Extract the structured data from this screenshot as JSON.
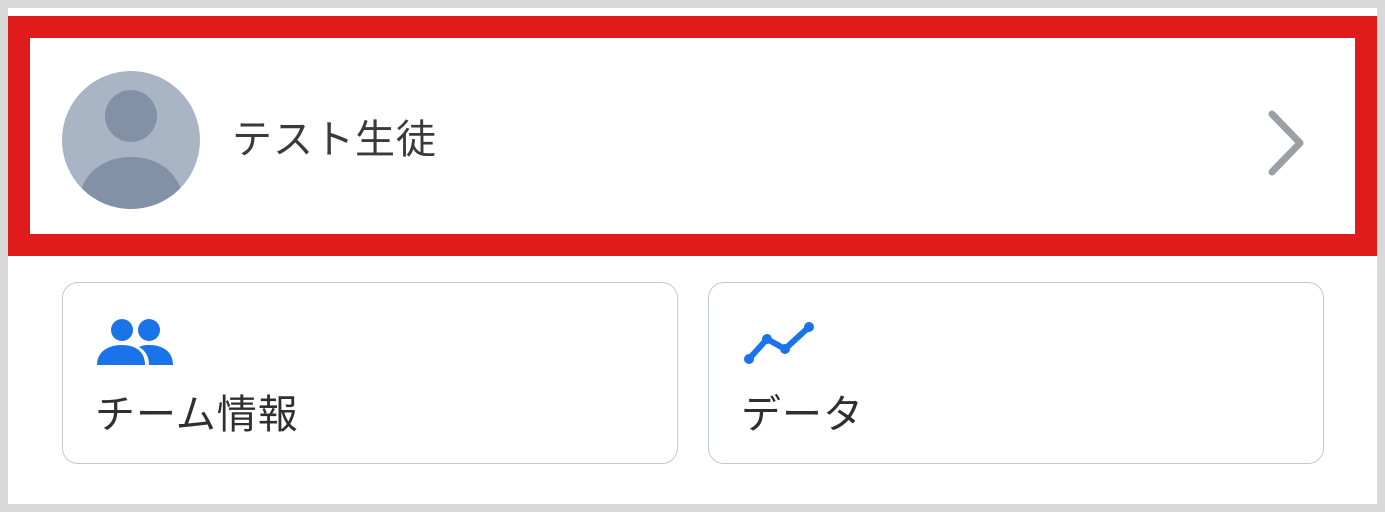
{
  "profile": {
    "name": "テスト生徒",
    "avatar_icon": "default-person-avatar-icon",
    "chevron_icon": "chevron-right-icon"
  },
  "cards": {
    "team": {
      "label": "チーム情報",
      "icon": "people-group-icon"
    },
    "data": {
      "label": "データ",
      "icon": "trending-line-icon"
    }
  },
  "colors": {
    "highlight_border": "#e01b1b",
    "accent_blue": "#1a73e8",
    "avatar_bg": "#a9b4c4",
    "avatar_figure": "#8391a7",
    "chevron": "#9aa0a6",
    "card_border": "#c4c8d0"
  }
}
